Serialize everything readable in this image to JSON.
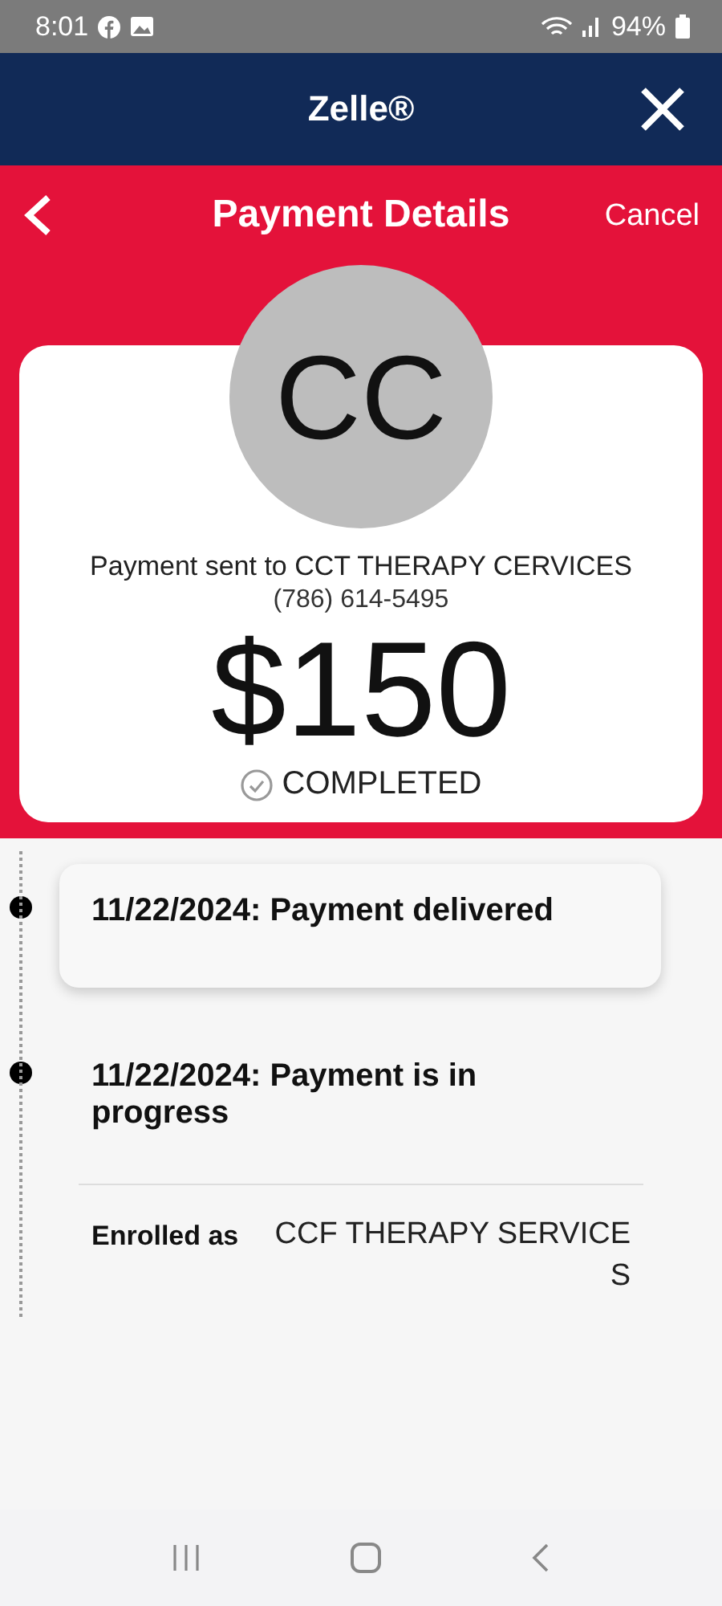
{
  "status_bar": {
    "time": "8:01",
    "battery": "94%"
  },
  "app_header": {
    "title": "Zelle®"
  },
  "nav_bar": {
    "title": "Payment Details",
    "cancel": "Cancel"
  },
  "payment": {
    "initials": "CC",
    "recipient": "Payment sent to CCT THERAPY CERVICES",
    "phone": "(786) 614-5495",
    "amount": "$150",
    "status": "COMPLETED"
  },
  "timeline": [
    {
      "text": "11/22/2024: Payment delivered",
      "selected": true
    },
    {
      "text": "11/22/2024: Payment is in progress",
      "selected": false
    }
  ],
  "enrollment": {
    "label": "Enrolled as",
    "value": "CCF THERAPY SERVICES"
  }
}
